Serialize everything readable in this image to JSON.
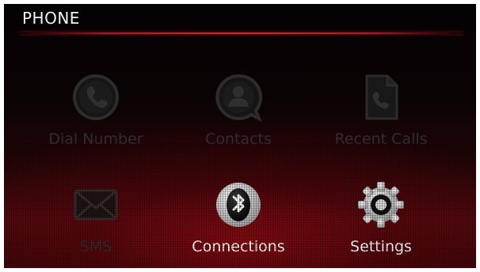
{
  "header": {
    "title": "PHONE"
  },
  "menu": {
    "items": [
      {
        "label": "Dial Number",
        "icon": "phone-handset-icon",
        "enabled": false
      },
      {
        "label": "Contacts",
        "icon": "contact-person-icon",
        "enabled": false
      },
      {
        "label": "Recent Calls",
        "icon": "recent-calls-document-icon",
        "enabled": false
      },
      {
        "label": "SMS",
        "icon": "envelope-icon",
        "enabled": false
      },
      {
        "label": "Connections",
        "icon": "bluetooth-icon",
        "enabled": true
      },
      {
        "label": "Settings",
        "icon": "gear-icon",
        "enabled": true
      }
    ]
  },
  "colors": {
    "accent_red": "#e21d25",
    "enabled_text": "#ffffff",
    "disabled_text": "#2e2e2e",
    "background": "#0b0304"
  }
}
